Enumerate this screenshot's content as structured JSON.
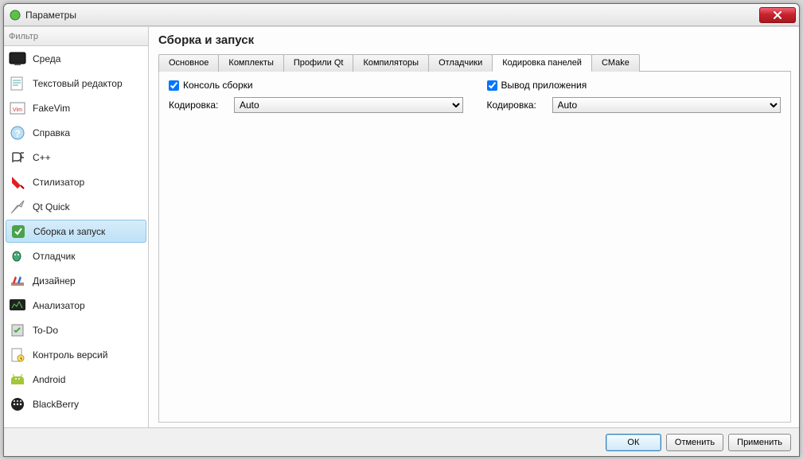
{
  "window": {
    "title": "Параметры"
  },
  "sidebar": {
    "filter_placeholder": "Фильтр",
    "items": [
      {
        "label": "Среда"
      },
      {
        "label": "Текстовый редактор"
      },
      {
        "label": "FakeVim"
      },
      {
        "label": "Справка"
      },
      {
        "label": "C++"
      },
      {
        "label": "Стилизатор"
      },
      {
        "label": "Qt Quick"
      },
      {
        "label": "Сборка и запуск"
      },
      {
        "label": "Отладчик"
      },
      {
        "label": "Дизайнер"
      },
      {
        "label": "Анализатор"
      },
      {
        "label": "To-Do"
      },
      {
        "label": "Контроль версий"
      },
      {
        "label": "Android"
      },
      {
        "label": "BlackBerry"
      }
    ],
    "selected_index": 7
  },
  "main": {
    "title": "Сборка и запуск",
    "tabs": [
      {
        "label": "Основное"
      },
      {
        "label": "Комплекты"
      },
      {
        "label": "Профили Qt"
      },
      {
        "label": "Компиляторы"
      },
      {
        "label": "Отладчики"
      },
      {
        "label": "Кодировка панелей"
      },
      {
        "label": "CMake"
      }
    ],
    "active_tab_index": 5,
    "panel": {
      "left": {
        "checkbox_label": "Консоль сборки",
        "checked": true,
        "encoding_label": "Кодировка:",
        "encoding_value": "Auto"
      },
      "right": {
        "checkbox_label": "Вывод приложения",
        "checked": true,
        "encoding_label": "Кодировка:",
        "encoding_value": "Auto"
      }
    }
  },
  "footer": {
    "ok": "ОК",
    "cancel": "Отменить",
    "apply": "Применить"
  }
}
